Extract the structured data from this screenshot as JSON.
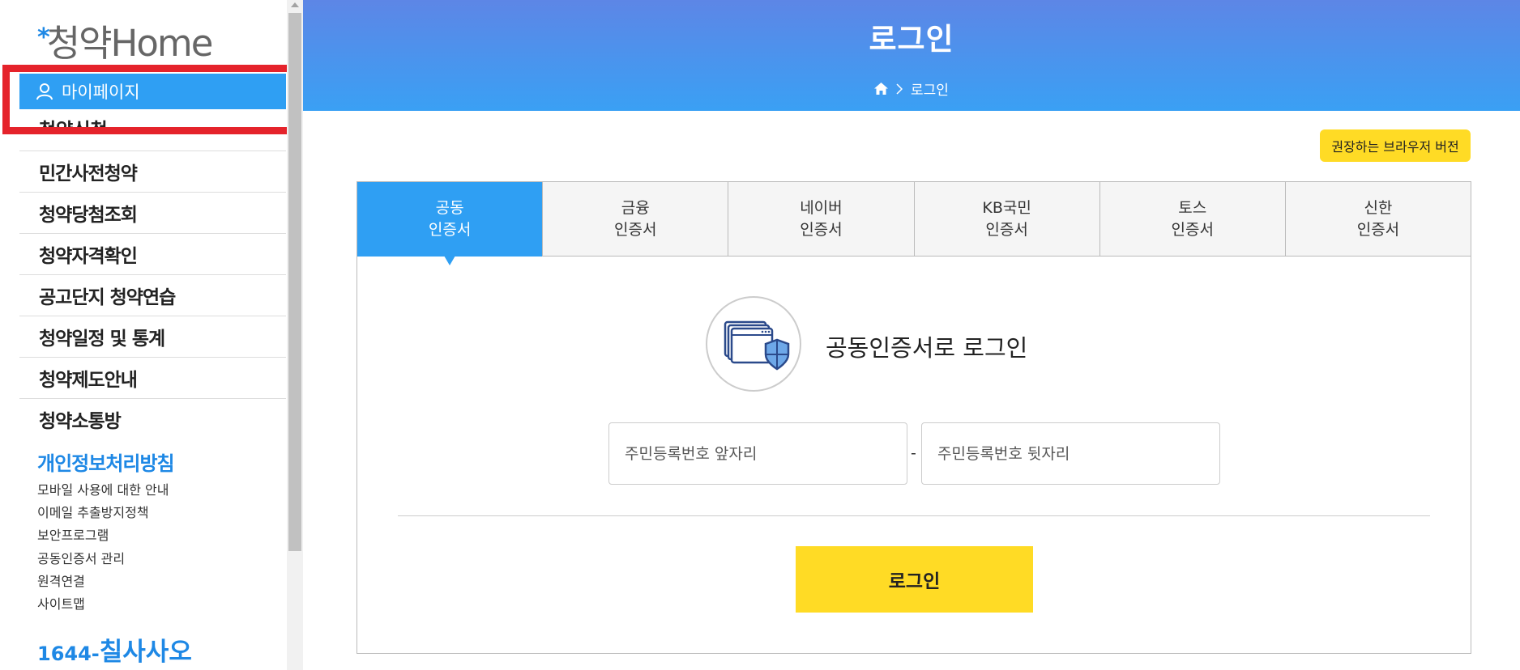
{
  "sidebar": {
    "logo_star": "*",
    "logo_text": "청약Home",
    "mypage_label": "마이페이지",
    "clipped_item": "청약신청",
    "menu_items": [
      "민간사전청약",
      "청약당첨조회",
      "청약자격확인",
      "공고단지 청약연습",
      "청약일정 및 통계",
      "청약제도안내",
      "청약소통방"
    ],
    "privacy_label": "개인정보처리방침",
    "sub_links": [
      "모바일 사용에 대한 안내",
      "이메일 추출방지정책",
      "보안프로그램",
      "공동인증서 관리",
      "원격연결",
      "사이트맵"
    ],
    "phone_prefix": "1644-",
    "phone_suffix": "칠사사오"
  },
  "header": {
    "title": "로그인",
    "breadcrumb_current": "로그인"
  },
  "main": {
    "browser_button": "권장하는 브라우저 버전",
    "tabs": [
      {
        "line1": "공동",
        "line2": "인증서"
      },
      {
        "line1": "금융",
        "line2": "인증서"
      },
      {
        "line1": "네이버",
        "line2": "인증서"
      },
      {
        "line1": "KB국민",
        "line2": "인증서"
      },
      {
        "line1": "토스",
        "line2": "인증서"
      },
      {
        "line1": "신한",
        "line2": "인증서"
      }
    ],
    "active_tab": 0,
    "cert_title": "공동인증서로 로그인",
    "rrn_front_placeholder": "주민등록번호 앞자리",
    "rrn_back_placeholder": "주민등록번호 뒷자리",
    "rrn_separator": "-",
    "login_button": "로그인"
  },
  "colors": {
    "accent_blue": "#2f9ff3",
    "highlight_red": "#e5232b",
    "button_yellow": "#ffdb25"
  }
}
